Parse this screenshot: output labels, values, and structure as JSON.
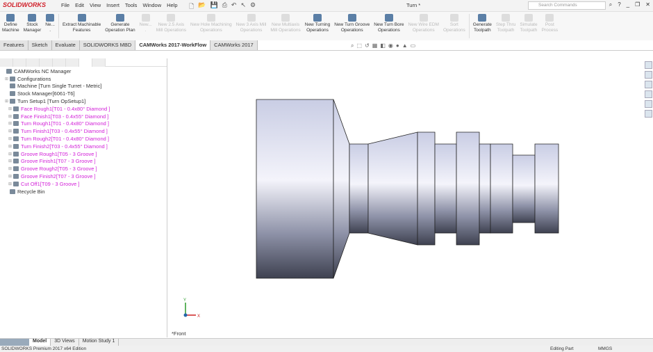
{
  "app": {
    "logo": "SOLIDWORKS",
    "title": "Turn *",
    "search_placeholder": "Search Commands"
  },
  "menu": [
    "File",
    "Edit",
    "View",
    "Insert",
    "Tools",
    "Window",
    "Help"
  ],
  "ribbon": [
    {
      "label": "Define\nMachine",
      "enabled": true
    },
    {
      "label": "Stock\nManager",
      "enabled": true
    },
    {
      "label": "Ne...\n.",
      "enabled": true
    },
    {
      "sep": true
    },
    {
      "label": "Extract Machinable\nFeatures",
      "enabled": true
    },
    {
      "label": "Generate\nOperation Plan",
      "enabled": true
    },
    {
      "label": "New...\n.",
      "enabled": false
    },
    {
      "label": "New 2.5 Axis\nMill Operations",
      "enabled": false
    },
    {
      "label": "New Hole Machining\nOperations",
      "enabled": false
    },
    {
      "label": "New 3 Axis Mill\nOperations",
      "enabled": false
    },
    {
      "label": "New Multiaxis\nMill Operations",
      "enabled": false
    },
    {
      "label": "New Turning\nOperations",
      "enabled": true
    },
    {
      "label": "New Turn Groove\nOperations",
      "enabled": true
    },
    {
      "label": "New Turn Bore\nOperations",
      "enabled": true
    },
    {
      "label": "New Wire EDM\nOperations",
      "enabled": false
    },
    {
      "label": "Sort\nOperations",
      "enabled": false
    },
    {
      "sep": true
    },
    {
      "label": "Generate\nToolpath",
      "enabled": true
    },
    {
      "label": "Step Thru\nToolpath",
      "enabled": false
    },
    {
      "label": "Simulate\nToolpath",
      "enabled": false
    },
    {
      "label": "Post\nProcess",
      "enabled": false
    }
  ],
  "tabs": [
    {
      "label": "Features"
    },
    {
      "label": "Sketch"
    },
    {
      "label": "Evaluate"
    },
    {
      "label": "SOLIDWORKS MBD"
    },
    {
      "label": "CAMWorks 2017-WorkFlow",
      "active": true
    },
    {
      "label": "CAMWorks 2017"
    }
  ],
  "tree": [
    {
      "label": "CAMWorks NC Manager",
      "level": 0
    },
    {
      "label": "Configurations",
      "level": 1,
      "expand": true
    },
    {
      "label": "Machine [Turn Single Turret - Metric]",
      "level": 1
    },
    {
      "label": "Stock Manager[6061-T6]",
      "level": 1
    },
    {
      "label": "Turn Setup1 [Turn OpSetup1]",
      "level": 1,
      "expand": true
    },
    {
      "label": "Face Rough1[T01 - 0.4x80° Diamond ]",
      "level": 2,
      "op": true
    },
    {
      "label": "Face Finish1[T03 - 0.4x55° Diamond ]",
      "level": 2,
      "op": true
    },
    {
      "label": "Turn Rough1[T01 - 0.4x80° Diamond ]",
      "level": 2,
      "op": true
    },
    {
      "label": "Turn Finish1[T03 - 0.4x55° Diamond ]",
      "level": 2,
      "op": true
    },
    {
      "label": "Turn Rough2[T01 - 0.4x80° Diamond ]",
      "level": 2,
      "op": true
    },
    {
      "label": "Turn Finish2[T03 - 0.4x55° Diamond ]",
      "level": 2,
      "op": true
    },
    {
      "label": "Groove Rough1[T05 - 3 Groove ]",
      "level": 2,
      "op": true
    },
    {
      "label": "Groove Finish1[T07 - 3 Groove ]",
      "level": 2,
      "op": true
    },
    {
      "label": "Groove Rough2[T05 - 3 Groove ]",
      "level": 2,
      "op": true
    },
    {
      "label": "Groove Finish2[T07 - 3 Groove ]",
      "level": 2,
      "op": true
    },
    {
      "label": "Cut Off1[T09 - 3 Groove ]",
      "level": 2,
      "op": true
    },
    {
      "label": "Recycle Bin",
      "level": 1
    }
  ],
  "viewport": {
    "view_name": "*Front",
    "axis_x": "X",
    "axis_y": "Y"
  },
  "bottom_tabs": [
    {
      "label": "Model",
      "active": true
    },
    {
      "label": "3D Views"
    },
    {
      "label": "Motion Study 1"
    }
  ],
  "status": {
    "edition": "SOLIDWORKS Premium 2017 x64 Edition",
    "mode": "Editing Part",
    "units": "MMGS"
  },
  "colors": {
    "operation_text": "#d21fd8",
    "logo": "#d0202a"
  }
}
